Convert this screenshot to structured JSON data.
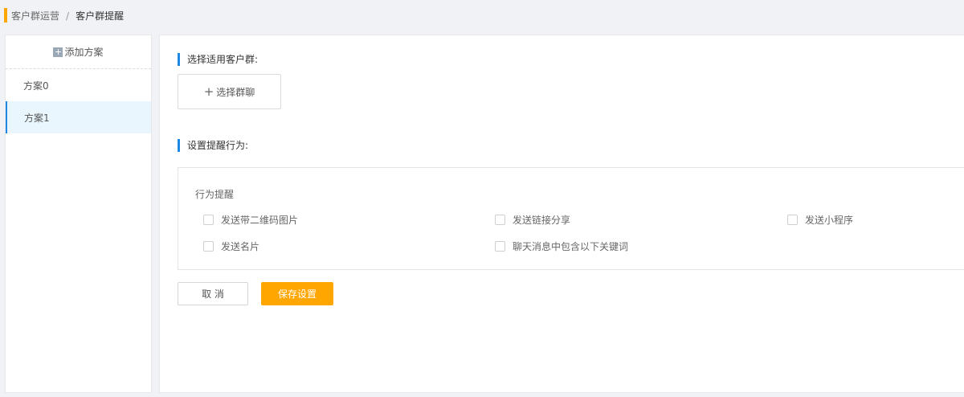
{
  "breadcrumb": {
    "parent": "客户群运营",
    "separator": "/",
    "current": "客户群提醒"
  },
  "sidebar": {
    "add_label": "添加方案",
    "add_icon": "plus-icon",
    "items": [
      {
        "label": "方案0",
        "active": false
      },
      {
        "label": "方案1",
        "active": true
      }
    ]
  },
  "main": {
    "section_group": "选择适用客户群:",
    "select_group_button": "选择群聊",
    "section_behavior": "设置提醒行为:",
    "behavior_title": "行为提醒",
    "options": [
      {
        "label": "发送带二维码图片",
        "checked": false
      },
      {
        "label": "发送链接分享",
        "checked": false
      },
      {
        "label": "发送小程序",
        "checked": false
      },
      {
        "label": "发送名片",
        "checked": false
      },
      {
        "label": "聊天消息中包含以下关键词",
        "checked": false
      }
    ],
    "cancel_button": "取 消",
    "save_button": "保存设置"
  },
  "colors": {
    "accent": "#ffa700",
    "primary_blue": "#1e88e5",
    "active_bg": "#eaf6fd"
  }
}
